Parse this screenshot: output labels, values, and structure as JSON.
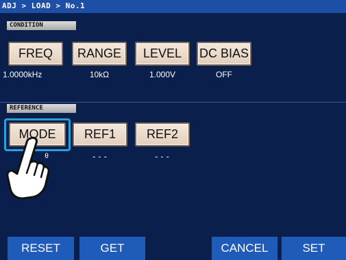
{
  "breadcrumb": "ADJ > LOAD > No.1",
  "condition": {
    "label": "CONDITION",
    "buttons": [
      {
        "label": "FREQ",
        "value": "1.0000kHz"
      },
      {
        "label": "RANGE",
        "value": "10kΩ"
      },
      {
        "label": "LEVEL",
        "value": "1.000V"
      },
      {
        "label": "DC BIAS",
        "value": "OFF"
      }
    ]
  },
  "reference": {
    "label": "REFERENCE",
    "buttons": [
      {
        "label": "MODE",
        "value": "θ"
      },
      {
        "label": "REF1",
        "value": "---"
      },
      {
        "label": "REF2",
        "value": "---"
      }
    ]
  },
  "footer": {
    "reset": "RESET",
    "get": "GET",
    "cancel": "CANCEL",
    "set": "SET"
  },
  "colors": {
    "background": "#0b1f4c",
    "topbar": "#1d4fa6",
    "button_face": "#e9d8c7",
    "footer_button": "#1f5bb8",
    "highlight": "#2aa0d6"
  },
  "icons": {
    "pointer": "hand-pointer-icon"
  }
}
